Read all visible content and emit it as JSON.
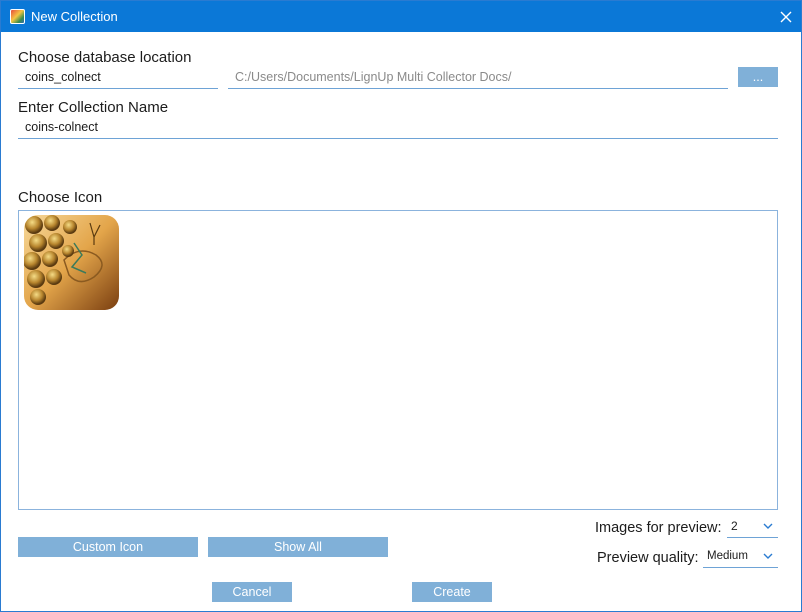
{
  "window": {
    "title": "New Collection",
    "accent_color": "#0b78d7",
    "app_icon": "lignup-app-icon",
    "close_icon": "close-icon"
  },
  "database": {
    "label": "Choose database location",
    "name_value": "coins_colnect",
    "path_value": "C:/Users/Documents/LignUp Multi Collector Docs/",
    "browse_label": "..."
  },
  "collection": {
    "label": "Enter Collection Name",
    "name_value": "coins-colnect"
  },
  "icon_chooser": {
    "label": "Choose Icon",
    "selected_icon": "treasure-map-coins-icon"
  },
  "buttons": {
    "custom_icon": "Custom Icon",
    "show_all": "Show All",
    "cancel": "Cancel",
    "create": "Create",
    "color": "#80b0d8"
  },
  "preview": {
    "images_label": "Images for preview:",
    "images_value": "2",
    "quality_label": "Preview quality:",
    "quality_value": "Medium"
  }
}
